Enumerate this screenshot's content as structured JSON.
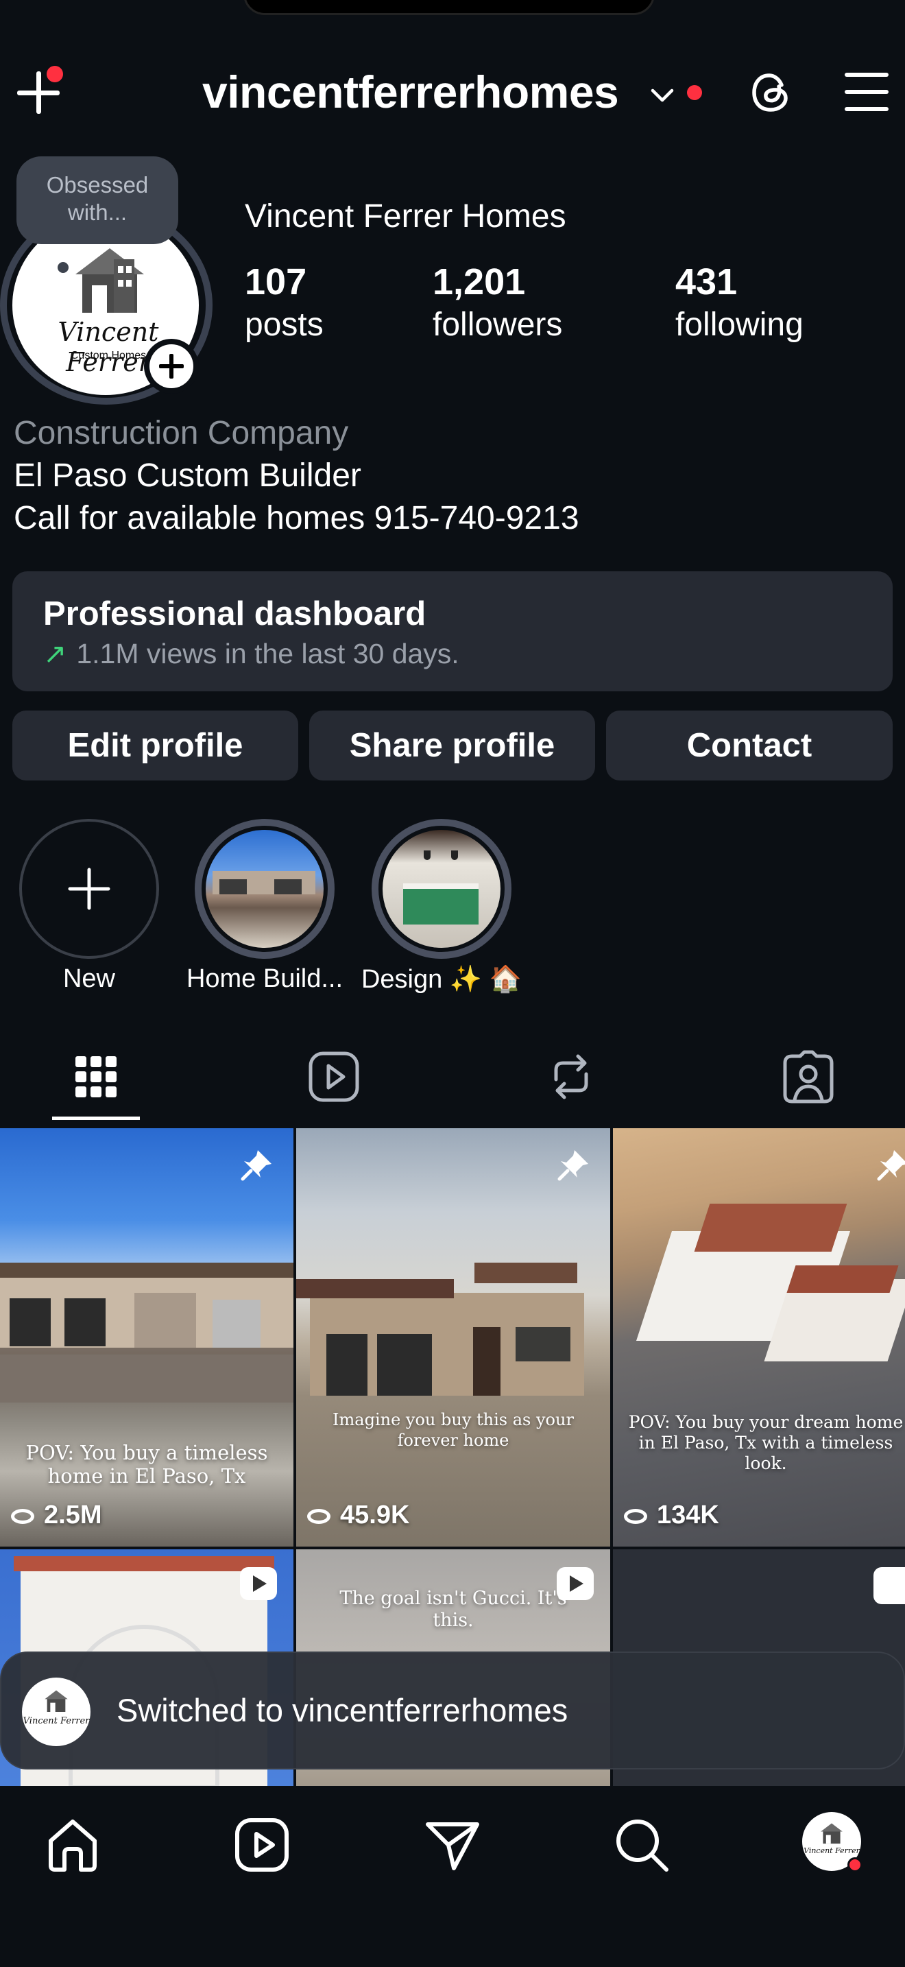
{
  "header": {
    "username": "vincentferrerhomes"
  },
  "note": {
    "text": "Obsessed with..."
  },
  "profile": {
    "display_name": "Vincent Ferrer Homes",
    "logo_text": "Vincent Ferrer",
    "logo_sub": "Custom Homes",
    "stats": [
      {
        "value": "107",
        "label": "posts"
      },
      {
        "value": "1,201",
        "label": "followers"
      },
      {
        "value": "431",
        "label": "following"
      }
    ],
    "category": "Construction Company",
    "bio_lines": [
      "El Paso Custom Builder",
      "Call for available homes 915-740-9213"
    ]
  },
  "dashboard": {
    "title": "Professional dashboard",
    "subtitle": "1.1M views in the last 30 days."
  },
  "buttons": {
    "edit": "Edit profile",
    "share": "Share profile",
    "contact": "Contact"
  },
  "highlights": [
    {
      "label": "New"
    },
    {
      "label": "Home Build..."
    },
    {
      "label": "Design ✨ 🏠"
    }
  ],
  "tabs": [
    "grid",
    "reels",
    "reposts",
    "tagged"
  ],
  "posts": [
    {
      "caption": "POV: You buy a timeless home in El Paso, Tx",
      "views": "2.5M",
      "pinned": true
    },
    {
      "caption": "Imagine you buy this as your forever home",
      "views": "45.9K",
      "pinned": true
    },
    {
      "caption": "POV: You buy your dream home in El Paso, Tx with a timeless look.",
      "views": "134K",
      "pinned": true
    },
    {
      "caption": "",
      "views": "",
      "pinned": false
    },
    {
      "caption": "The goal isn't Gucci. It's this.",
      "views": "",
      "pinned": false
    },
    {
      "caption": "",
      "views": "",
      "pinned": false
    }
  ],
  "toast": {
    "text": "Switched to vincentferrerhomes"
  },
  "colors": {
    "background": "#0b0f14",
    "surface": "#262a33",
    "notification_red": "#ff3040",
    "trend_green": "#3fd37a"
  }
}
